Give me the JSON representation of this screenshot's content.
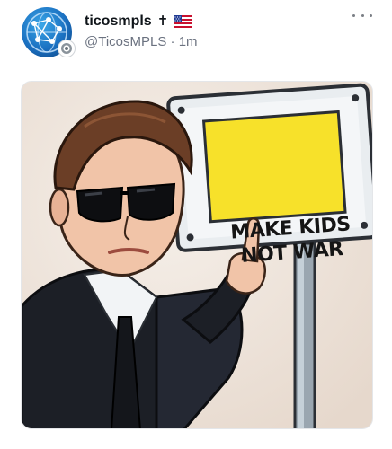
{
  "post": {
    "author": {
      "display_name": "ticosmpls",
      "name_emoji": "✝",
      "flag_icon": "us-flag-icon",
      "handle": "@TicosMPLS",
      "separator": "·",
      "timestamp": "1m",
      "avatar_icon": "globe-network-avatar",
      "badge_icon": "seal-badge-icon"
    },
    "menu_icon": "more-horizontal-icon",
    "media": {
      "sign_line1": "MAKE KIDS",
      "sign_line2": "NOT WAR",
      "colors": {
        "sign_yellow": "#f7e12a",
        "suit": "#1c1f26",
        "skin": "#f1c4a8",
        "hair": "#6b3e26",
        "background": "#efe6dd"
      }
    }
  }
}
